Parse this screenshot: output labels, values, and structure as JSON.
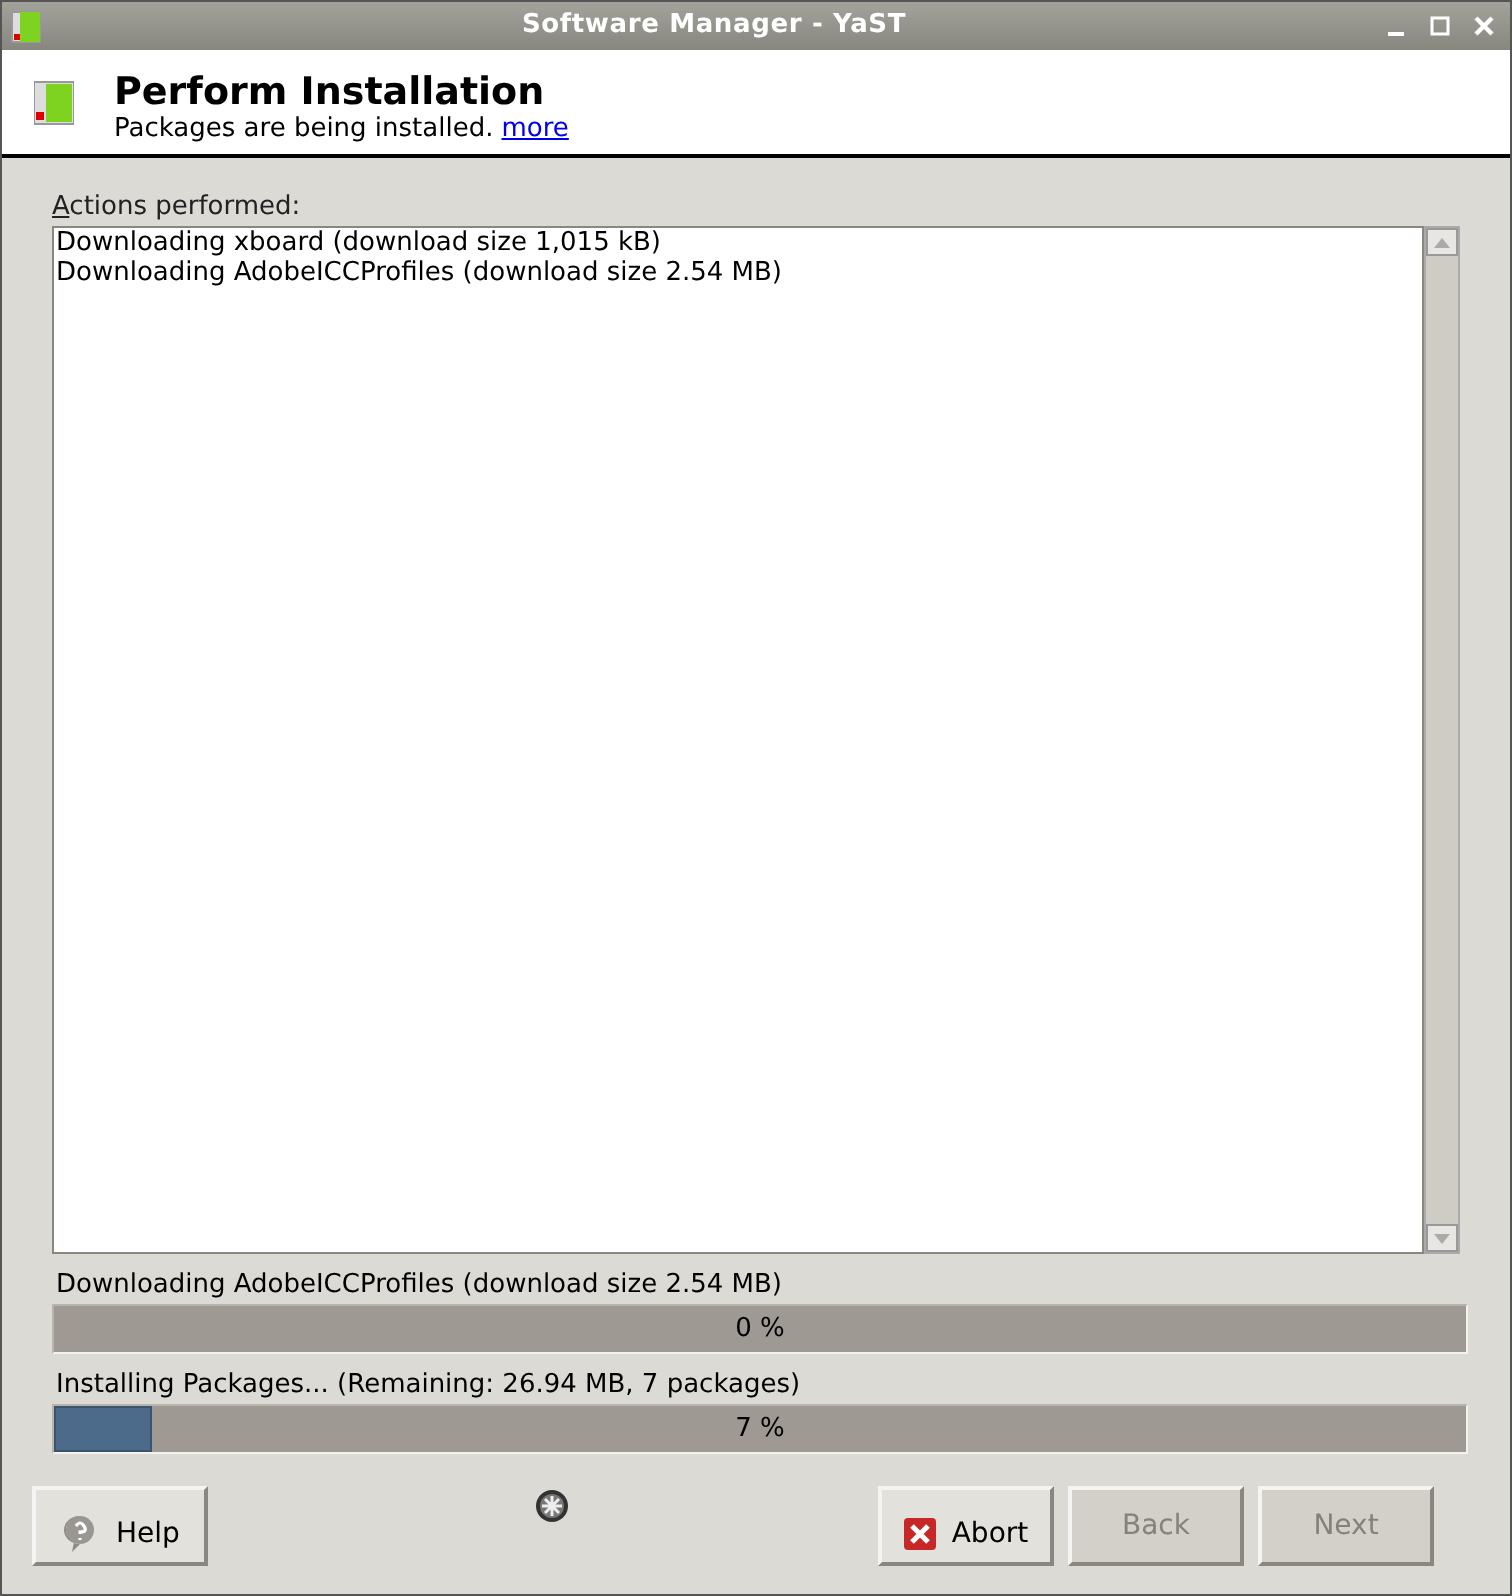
{
  "window": {
    "title": "Software Manager - YaST"
  },
  "header": {
    "title": "Perform Installation",
    "subtitle": "Packages are being installed.",
    "link": "more"
  },
  "log": {
    "label": "Actions performed:",
    "lines": [
      "Downloading xboard (download size 1,015 kB)",
      "Downloading AdobeICCProfiles (download size 2.54 MB)"
    ]
  },
  "progress": [
    {
      "label": "Downloading AdobeICCProfiles (download size 2.54 MB)",
      "reading": "0 %",
      "level": 0
    },
    {
      "label": "Installing Packages... (Remaining: 26.94 MB, 7 packages)",
      "reading": "7 %",
      "level": 0.07
    }
  ],
  "buttons": [
    {
      "label": "Help",
      "kind": "help",
      "disabled": false
    },
    {
      "label": "Abort",
      "kind": "abort",
      "disabled": false
    },
    {
      "label": "Back",
      "kind": "plain",
      "disabled": true
    },
    {
      "label": "Next",
      "kind": "plain",
      "disabled": true
    }
  ]
}
